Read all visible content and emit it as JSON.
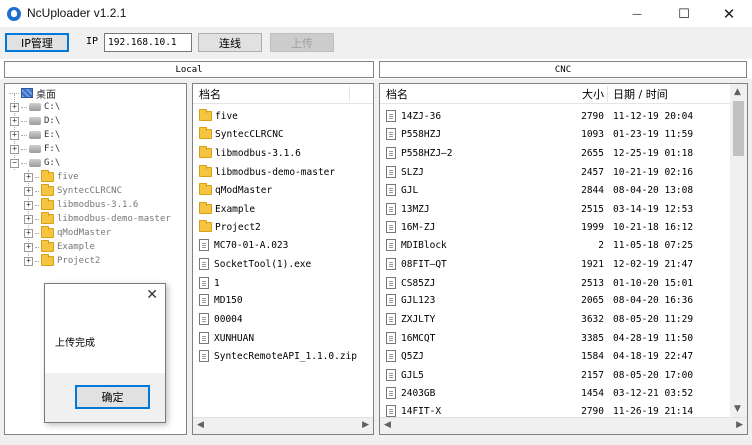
{
  "window": {
    "title": "NcUploader v1.2.1"
  },
  "toolbar": {
    "ip_manage_label": "IP管理",
    "ip_label": "IP",
    "ip_value": "192.168.10.1",
    "connect_label": "连线",
    "upload_label": "上传"
  },
  "sections": {
    "local": "Local",
    "cnc": "CNC"
  },
  "tree": {
    "root": "桌面",
    "drives": [
      "C:\\",
      "D:\\",
      "E:\\",
      "F:\\",
      "G:\\"
    ],
    "g_children": [
      "five",
      "SyntecCLRCNC",
      "libmodbus-3.1.6",
      "libmodbus-demo-master",
      "qModMaster",
      "Example",
      "Project2"
    ]
  },
  "local_files": {
    "header": "档名",
    "items": [
      {
        "name": "five",
        "type": "folder"
      },
      {
        "name": "SyntecCLRCNC",
        "type": "folder"
      },
      {
        "name": "libmodbus-3.1.6",
        "type": "folder"
      },
      {
        "name": "libmodbus-demo-master",
        "type": "folder"
      },
      {
        "name": "qModMaster",
        "type": "folder"
      },
      {
        "name": "Example",
        "type": "folder"
      },
      {
        "name": "Project2",
        "type": "folder"
      },
      {
        "name": "MC70-01-A.023",
        "type": "file"
      },
      {
        "name": "SocketTool(1).exe",
        "type": "file"
      },
      {
        "name": "1",
        "type": "file"
      },
      {
        "name": "MD150",
        "type": "file"
      },
      {
        "name": "00004",
        "type": "file"
      },
      {
        "name": "XUNHUAN",
        "type": "file"
      },
      {
        "name": "SyntecRemoteAPI_1.1.0.zip",
        "type": "file"
      }
    ]
  },
  "cnc_files": {
    "headers": {
      "name": "档名",
      "size": "大小",
      "date": "日期 / 时间"
    },
    "rows": [
      {
        "name": "14ZJ-36",
        "size": "2790",
        "date": "11-12-19 20:04"
      },
      {
        "name": "P558HZJ",
        "size": "1093",
        "date": "01-23-19 11:59"
      },
      {
        "name": "P558HZJ—2",
        "size": "2655",
        "date": "12-25-19 01:18"
      },
      {
        "name": "SLZJ",
        "size": "2457",
        "date": "10-21-19 02:16"
      },
      {
        "name": "GJL",
        "size": "2844",
        "date": "08-04-20 13:08"
      },
      {
        "name": "13MZJ",
        "size": "2515",
        "date": "03-14-19 12:53"
      },
      {
        "name": "16M-ZJ",
        "size": "1999",
        "date": "10-21-18 16:12"
      },
      {
        "name": "MDIBlock",
        "size": "2",
        "date": "11-05-18 07:25"
      },
      {
        "name": "08FIT—QT",
        "size": "1921",
        "date": "12-02-19 21:47"
      },
      {
        "name": "CS85ZJ",
        "size": "2513",
        "date": "01-10-20 15:01"
      },
      {
        "name": "GJL123",
        "size": "2065",
        "date": "08-04-20 16:36"
      },
      {
        "name": "ZXJLTY",
        "size": "3632",
        "date": "08-05-20 11:29"
      },
      {
        "name": "16MCQT",
        "size": "3385",
        "date": "04-28-19 11:50"
      },
      {
        "name": "Q5ZJ",
        "size": "1584",
        "date": "04-18-19 22:47"
      },
      {
        "name": "GJL5",
        "size": "2157",
        "date": "08-05-20 17:00"
      },
      {
        "name": "2403GB",
        "size": "1454",
        "date": "03-12-21 03:52"
      },
      {
        "name": "14FIT-X",
        "size": "2790",
        "date": "11-26-19 21:14"
      }
    ]
  },
  "dialog": {
    "message": "上传完成",
    "ok_label": "确定"
  }
}
